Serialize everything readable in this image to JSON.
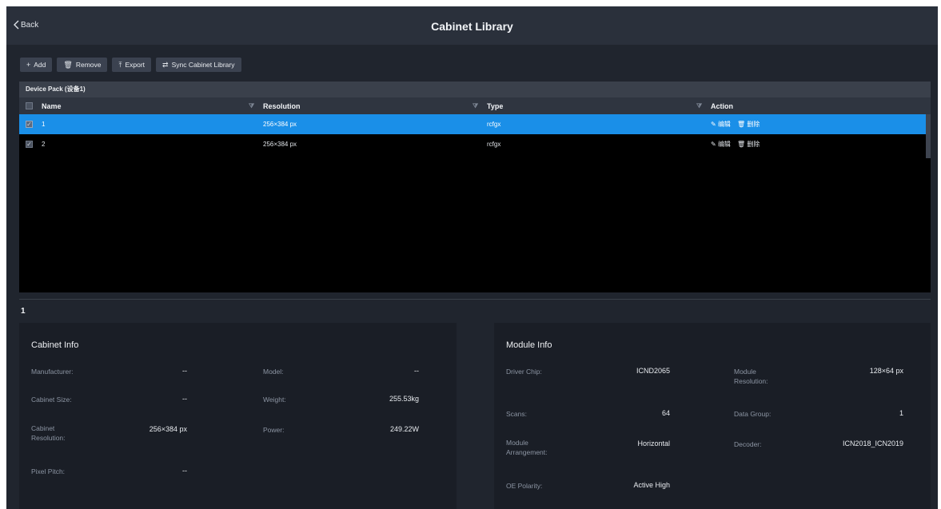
{
  "header": {
    "back_label": "Back",
    "title": "Cabinet Library"
  },
  "toolbar": {
    "add": "Add",
    "remove": "Remove",
    "export": "Export",
    "sync": "Sync Cabinet Library",
    "add_icon": "+",
    "remove_icon": "🗑",
    "export_icon": "⤒",
    "sync_icon": "⇄"
  },
  "device_pack": "Device Pack (设备1)",
  "columns": {
    "name": "Name",
    "resolution": "Resolution",
    "type": "Type",
    "action": "Action"
  },
  "rows": [
    {
      "name": "1",
      "resolution": "256×384 px",
      "type": "rcfgx",
      "edit": "编辑",
      "delete": "删除",
      "checked": "✓"
    },
    {
      "name": "2",
      "resolution": "256×384 px",
      "type": "rcfgx",
      "edit": "编辑",
      "delete": "删除",
      "checked": "✓"
    }
  ],
  "selected_label": "1",
  "cabinet_info": {
    "title": "Cabinet Info",
    "manufacturer_label": "Manufacturer:",
    "manufacturer": "--",
    "model_label": "Model:",
    "model": "--",
    "size_label": "Cabinet Size:",
    "size": "--",
    "weight_label": "Weight:",
    "weight": "255.53kg",
    "resolution_label": "Cabinet Resolution:",
    "resolution": "256×384 px",
    "power_label": "Power:",
    "power": "249.22W",
    "pitch_label": "Pixel Pitch:",
    "pitch": "--"
  },
  "module_info": {
    "title": "Module Info",
    "chip_label": "Driver Chip:",
    "chip": "ICND2065",
    "mres_label": "Module Resolution:",
    "mres": "128×64 px",
    "scans_label": "Scans:",
    "scans": "64",
    "group_label": "Data Group:",
    "group": "1",
    "arr_label": "Module Arrangement:",
    "arr": "Horizontal",
    "decoder_label": "Decoder:",
    "decoder": "ICN2018_ICN2019",
    "oe_label": "OE Polarity:",
    "oe": "Active High"
  },
  "colors": {
    "accent": "#1a8fe8",
    "background": "#20252e",
    "panel": "#1a1e26"
  }
}
